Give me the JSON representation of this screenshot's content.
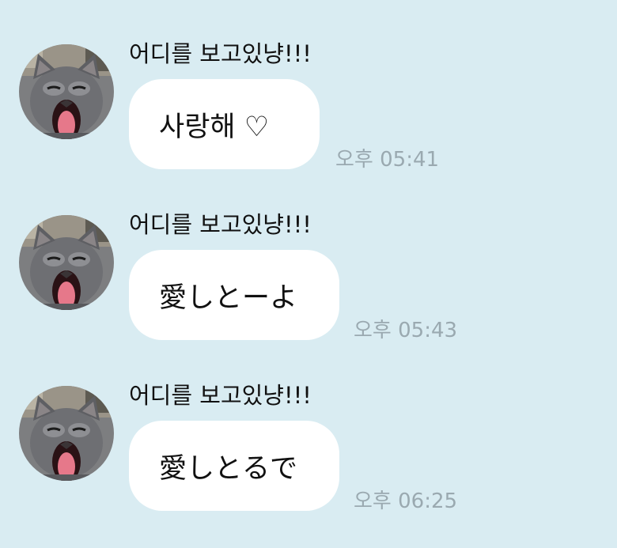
{
  "theme": {
    "background": "#d9ecf2",
    "bubble_color": "#ffffff",
    "time_color": "#9aa9b0"
  },
  "messages": [
    {
      "sender": "어디를 보고있냥!!!",
      "text": "사랑해 ♡",
      "time": "오후 05:41",
      "avatar_icon": "cat-avatar-icon"
    },
    {
      "sender": "어디를 보고있냥!!!",
      "text": "愛しとーよ",
      "time": "오후 05:43",
      "avatar_icon": "cat-avatar-icon"
    },
    {
      "sender": "어디를 보고있냥!!!",
      "text": "愛しとるで",
      "time": "오후 06:25",
      "avatar_icon": "cat-avatar-icon"
    }
  ]
}
